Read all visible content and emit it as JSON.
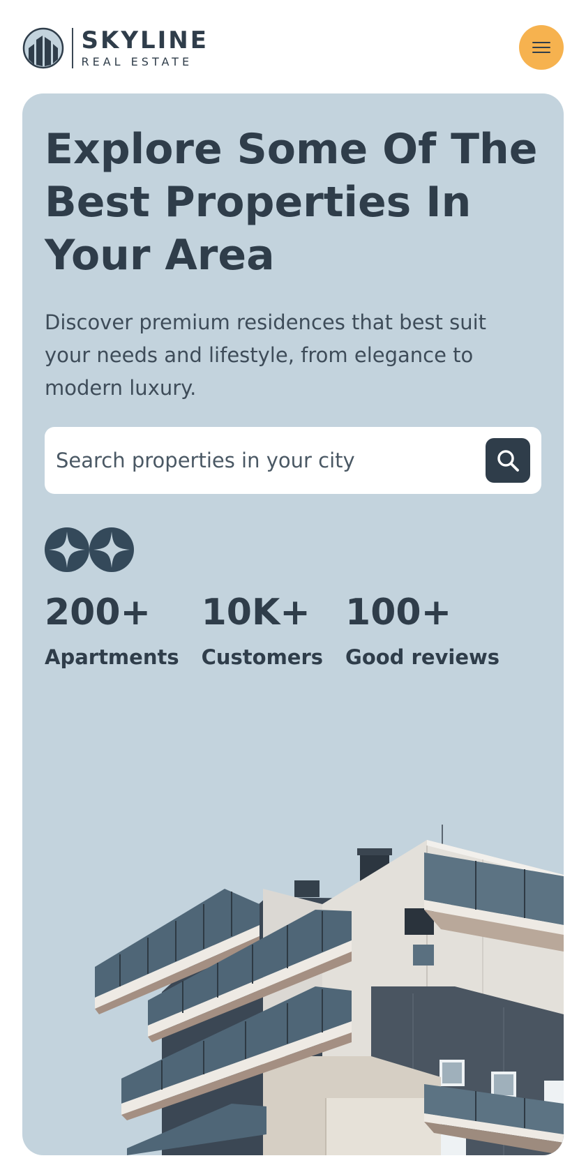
{
  "brand": {
    "name": "SKYLINE",
    "tagline": "REAL ESTATE",
    "logo_icon": "building-icon",
    "accent_color": "#f6b24f",
    "dark_color": "#2f3d4a",
    "hero_bg_color": "#c3d3dd"
  },
  "header": {
    "menu_icon": "hamburger-icon"
  },
  "hero": {
    "title": "Explore Some Of The Best Properties In Your Area",
    "subtitle": "Discover premium residences that best suit your needs and lifestyle, from elegance to modern luxury.",
    "search": {
      "placeholder": "Search properties in your city",
      "icon": "search-icon"
    },
    "decor_icons": [
      "sparkle-icon",
      "sparkle-icon"
    ],
    "stats": [
      {
        "value": "200+",
        "label": "Apartments"
      },
      {
        "value": "10K+",
        "label": "Customers"
      },
      {
        "value": "100+",
        "label": "Good reviews"
      }
    ],
    "image": "modern-apartment-building"
  }
}
